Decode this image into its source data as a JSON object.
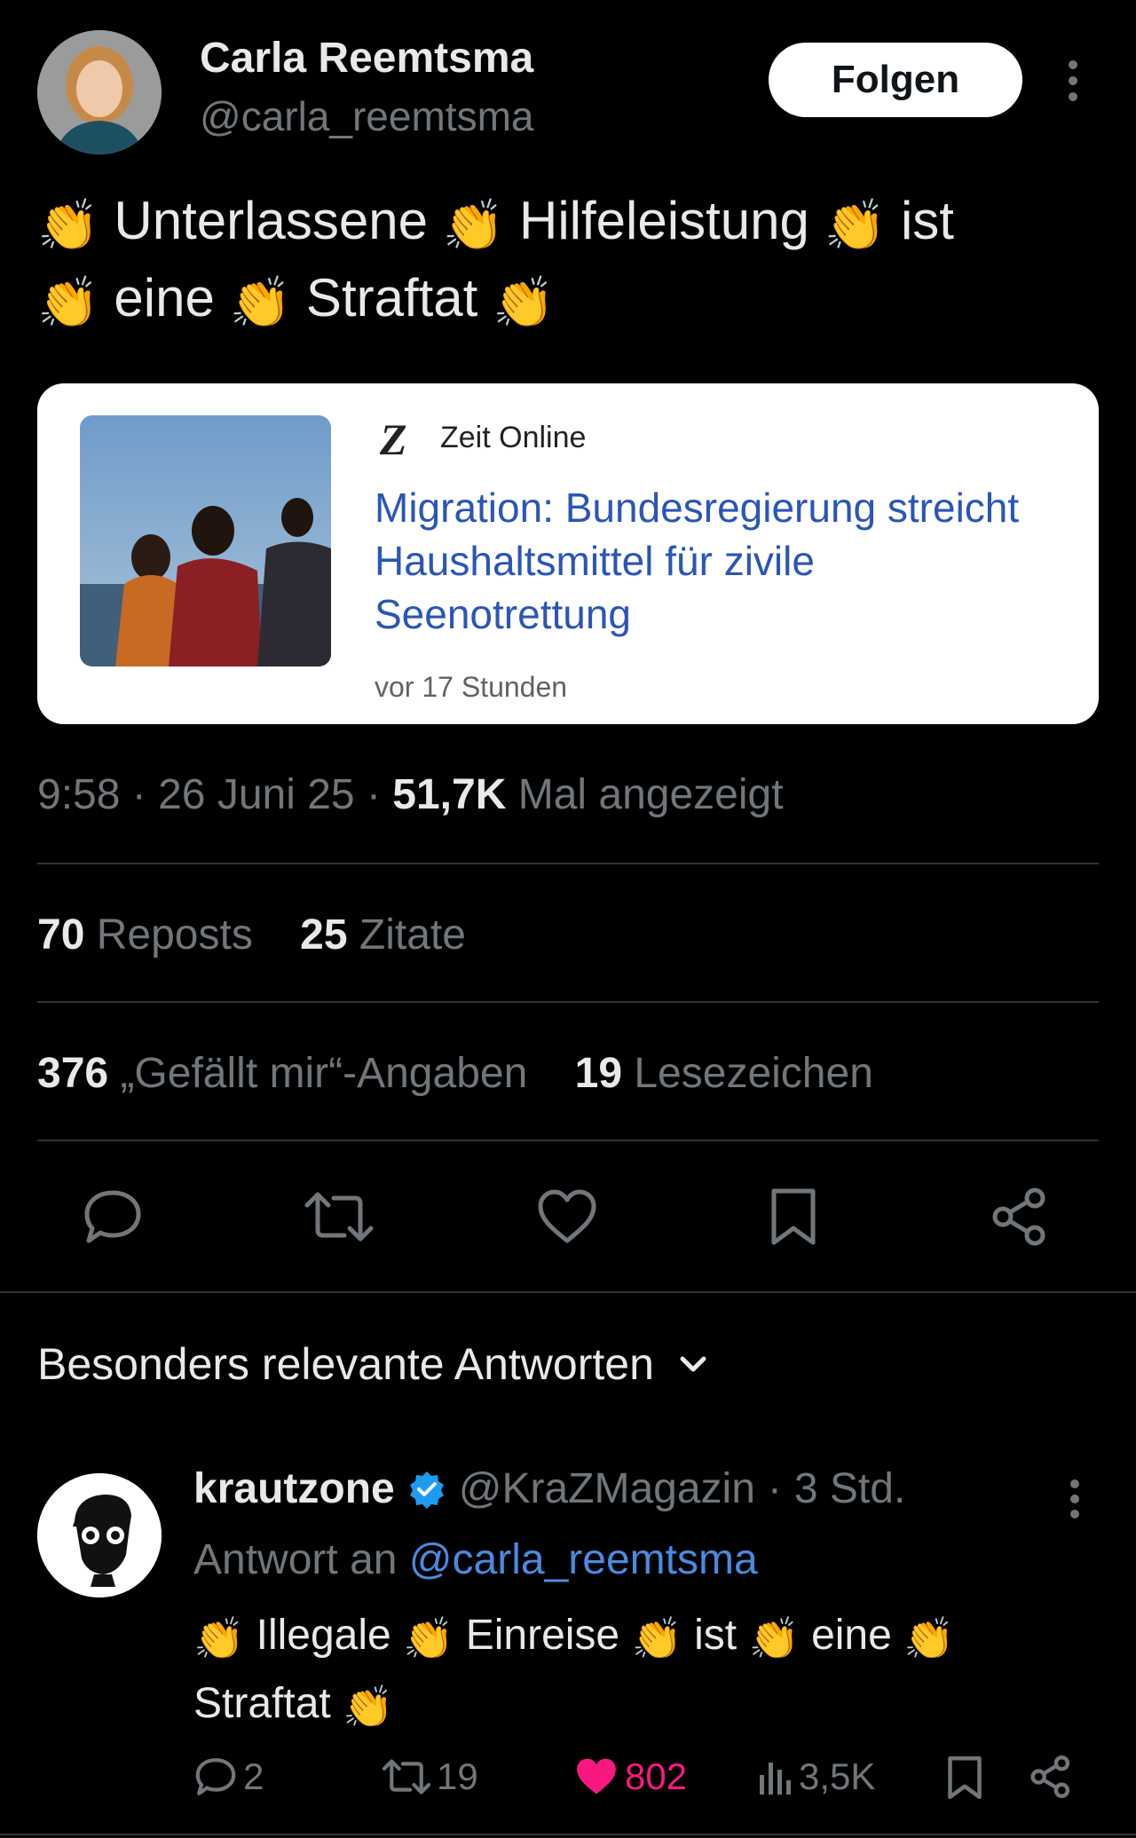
{
  "tweet": {
    "author_name": "Carla Reemtsma",
    "author_handle": "@carla_reemtsma",
    "follow_label": "Folgen",
    "text_parts": [
      "Unterlassene",
      "Hilfeleistung",
      "ist",
      "eine",
      "Straftat"
    ],
    "emoji": "👏",
    "card": {
      "source_logo": "Z",
      "source": "Zeit Online",
      "headline": "Migration: Bundesregierung streicht Haushaltsmittel für zivile Seenotrettung",
      "time": "vor 17 Stunden"
    },
    "meta": {
      "time": "9:58",
      "date": "26 Juni 25",
      "views": "51,7K",
      "views_label": "Mal angezeigt",
      "sep": "·"
    },
    "stats": {
      "reposts": "70",
      "reposts_label": "Reposts",
      "quotes": "25",
      "quotes_label": "Zitate",
      "likes": "376",
      "likes_label": "„Gefällt mir“-Angaben",
      "bookmarks": "19",
      "bookmarks_label": "Lesezeichen"
    },
    "actions": [
      "reply-icon",
      "repost-icon",
      "like-icon",
      "bookmark-icon",
      "share-icon"
    ]
  },
  "replies_section": {
    "label": "Besonders relevante Antworten"
  },
  "reply": {
    "name": "krautzone",
    "handle": "@KraZMagazin",
    "sep": "·",
    "time": "3 Std.",
    "reply_to_label": "Antwort an",
    "reply_to_handle": "@carla_reemtsma",
    "text_parts": [
      "Illegale",
      "Einreise",
      "ist",
      "eine",
      "Straftat"
    ],
    "counts": {
      "replies": "2",
      "reposts": "19",
      "likes": "802",
      "views": "3,5K"
    }
  },
  "colors": {
    "background": "#000000",
    "text": "#e7e9ea",
    "muted": "#71767b",
    "link": "#4a8ae0",
    "like_active": "#f91880",
    "verified": "#1d9bf0",
    "card_headline": "#2b56b8"
  }
}
